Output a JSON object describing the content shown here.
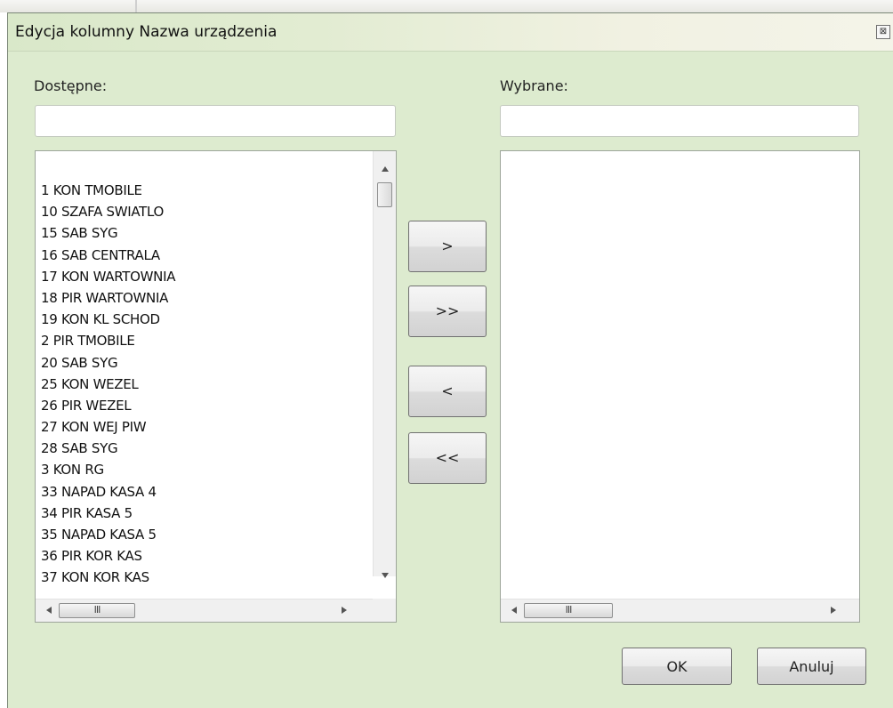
{
  "dialog": {
    "title": "Edycja kolumny Nazwa urządzenia",
    "close_glyph": "⊠"
  },
  "available": {
    "label": "Dostępne:",
    "search_value": "",
    "items": [
      "1 KON TMOBILE",
      "10 SZAFA SWIATLO",
      "15 SAB SYG",
      "16 SAB CENTRALA",
      "17 KON WARTOWNIA",
      "18 PIR WARTOWNIA",
      "19 KON KL SCHOD",
      "2 PIR TMOBILE",
      "20 SAB SYG",
      "25 KON WEZEL",
      "26 PIR WEZEL",
      "27 KON WEJ PIW",
      "28 SAB SYG",
      "3 KON RG",
      "33 NAPAD KASA 4",
      "34 PIR KASA 5",
      "35 NAPAD KASA 5",
      "36 PIR KOR KAS",
      "37 KON KOR KAS"
    ],
    "hscroll_grip": "III"
  },
  "selected": {
    "label": "Wybrane:",
    "search_value": "",
    "items": [],
    "hscroll_grip": "III"
  },
  "transfer_buttons": {
    "add_one": ">",
    "add_all": ">>",
    "remove_one": "<",
    "remove_all": "<<"
  },
  "footer": {
    "ok_label": "OK",
    "cancel_label": "Anuluj"
  }
}
